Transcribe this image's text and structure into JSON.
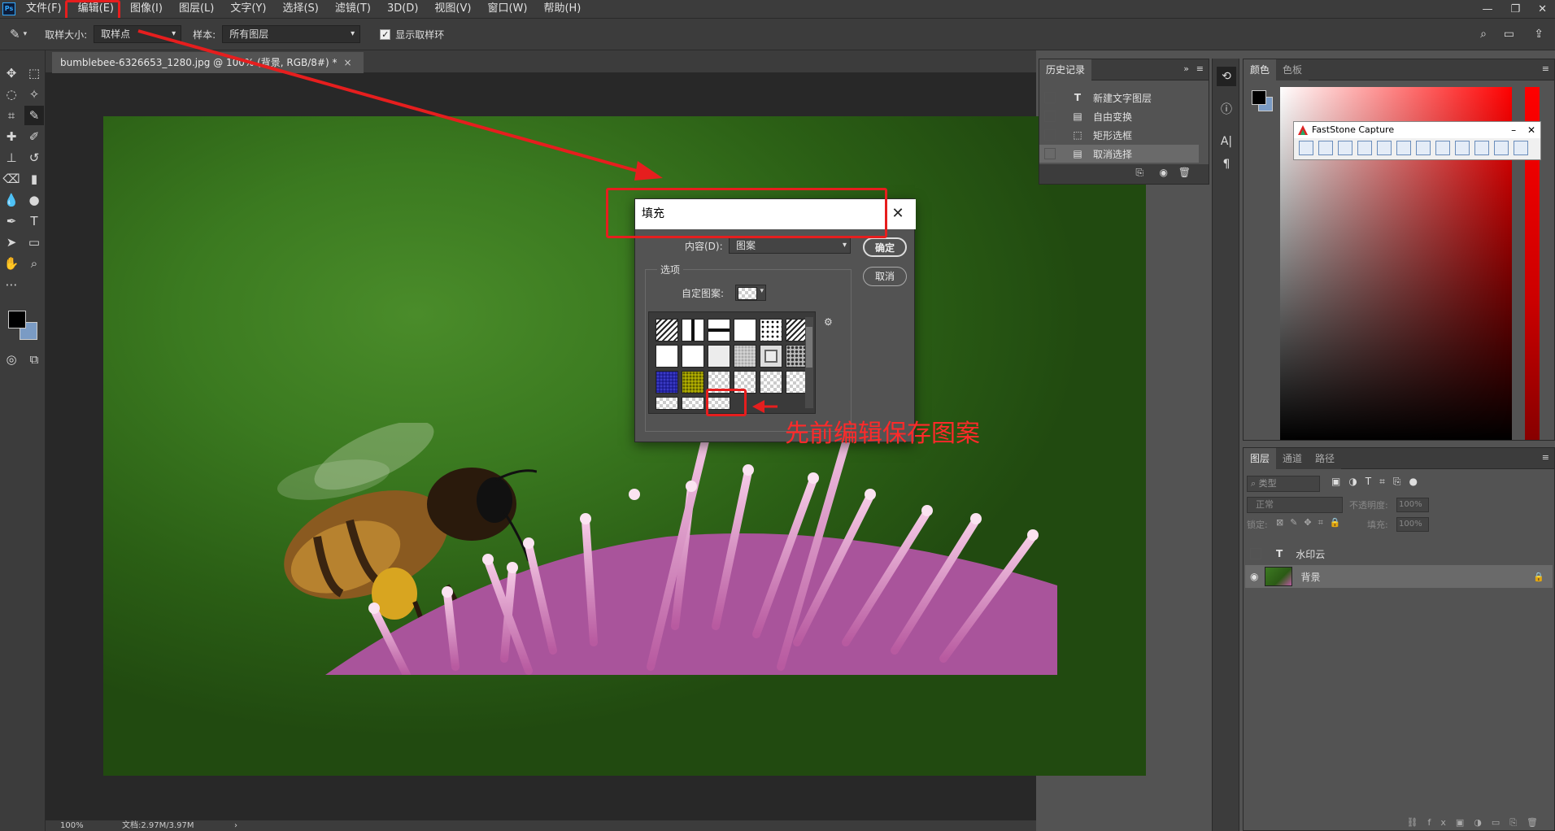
{
  "menubar": {
    "logo": "Ps",
    "items": [
      "文件(F)",
      "编辑(E)",
      "图像(I)",
      "图层(L)",
      "文字(Y)",
      "选择(S)",
      "滤镜(T)",
      "3D(D)",
      "视图(V)",
      "窗口(W)",
      "帮助(H)"
    ],
    "window_controls": [
      "—",
      "❐",
      "✕"
    ]
  },
  "optbar": {
    "sample_size_label": "取样大小:",
    "sample_size_value": "取样点",
    "sample_label": "样本:",
    "sample_value": "所有图层",
    "show_ring_label": "显示取样环"
  },
  "document": {
    "tab_title": "bumblebee-6326653_1280.jpg @ 100% (背景, RGB/8#) *",
    "tab_close": "×",
    "zoom": "100%",
    "doc_info": "文档:2.97M/3.97M",
    "status_arrow": "›"
  },
  "history": {
    "tab": "历史记录",
    "items": [
      {
        "icon": "T",
        "label": "新建文字图层"
      },
      {
        "icon": "▤",
        "label": "自由变换"
      },
      {
        "icon": "⬚",
        "label": "矩形选框"
      },
      {
        "icon": "▤",
        "label": "取消选择"
      }
    ]
  },
  "color_panel": {
    "tabs": [
      "颜色",
      "色板"
    ]
  },
  "faststone": {
    "title": "FastStone Capture",
    "buttons": [
      "–",
      "✕"
    ]
  },
  "layers": {
    "tabs": [
      "图层",
      "通道",
      "路径"
    ],
    "filter_label": "类型",
    "blend_mode": "正常",
    "opacity_label": "不透明度:",
    "opacity_value": "100%",
    "lock_label": "锁定:",
    "fill_label": "填充:",
    "fill_value": "100%",
    "rows": [
      {
        "name": "水印云",
        "type_icon": "T"
      },
      {
        "name": "背景"
      }
    ]
  },
  "dialog": {
    "title": "填充",
    "content_label": "内容(D):",
    "content_value": "图案",
    "ok_label": "确定",
    "cancel_label": "取消",
    "options_label": "选项",
    "custom_pattern_label": "自定图案:"
  },
  "annotation": {
    "text": "先前编辑保存图案"
  }
}
